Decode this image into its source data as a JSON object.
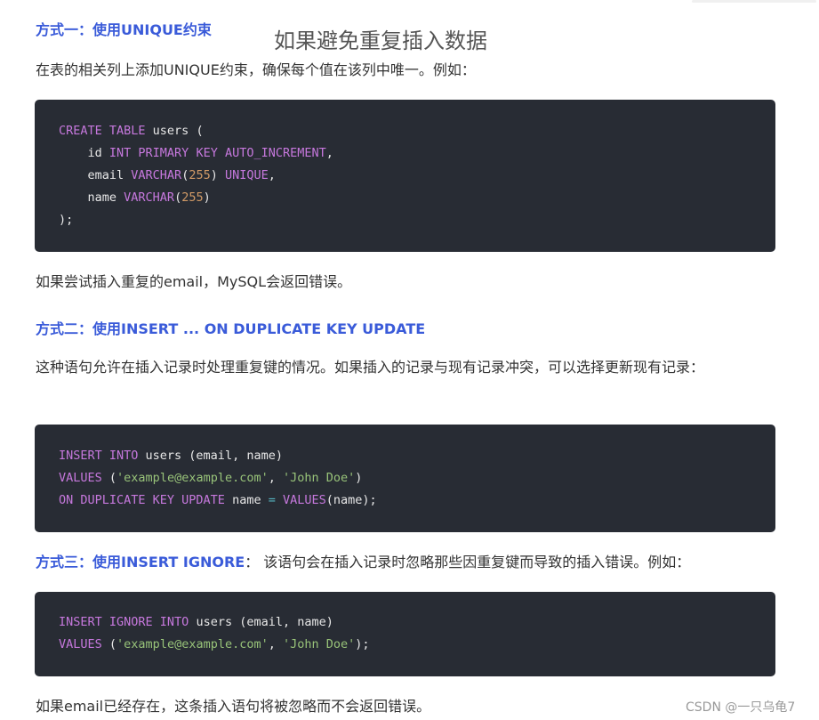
{
  "title": "如果避免重复插入数据",
  "section1": {
    "heading": "方式一：使用UNIQUE约束",
    "desc": "在表的相关列上添加UNIQUE约束，确保每个值在该列中唯一。例如：",
    "code": [
      [
        {
          "t": "kw",
          "v": "CREATE TABLE"
        },
        {
          "t": "plain",
          "v": " users ("
        }
      ],
      [
        {
          "t": "plain",
          "v": "    id "
        },
        {
          "t": "kw",
          "v": "INT PRIMARY KEY AUTO_INCREMENT"
        },
        {
          "t": "plain",
          "v": ","
        }
      ],
      [
        {
          "t": "plain",
          "v": "    email "
        },
        {
          "t": "kw",
          "v": "VARCHAR"
        },
        {
          "t": "plain",
          "v": "("
        },
        {
          "t": "num",
          "v": "255"
        },
        {
          "t": "plain",
          "v": ") "
        },
        {
          "t": "kw",
          "v": "UNIQUE"
        },
        {
          "t": "plain",
          "v": ","
        }
      ],
      [
        {
          "t": "plain",
          "v": "    name "
        },
        {
          "t": "kw",
          "v": "VARCHAR"
        },
        {
          "t": "plain",
          "v": "("
        },
        {
          "t": "num",
          "v": "255"
        },
        {
          "t": "plain",
          "v": ")"
        }
      ],
      [
        {
          "t": "plain",
          "v": ");"
        }
      ]
    ],
    "note": "如果尝试插入重复的email，MySQL会返回错误。"
  },
  "section2": {
    "heading": "方式二：使用INSERT ... ON DUPLICATE KEY UPDATE",
    "desc": "这种语句允许在插入记录时处理重复键的情况。如果插入的记录与现有记录冲突，可以选择更新现有记录：",
    "code": [
      [
        {
          "t": "kw",
          "v": "INSERT INTO"
        },
        {
          "t": "plain",
          "v": " users (email, name)"
        }
      ],
      [
        {
          "t": "kw",
          "v": "VALUES"
        },
        {
          "t": "plain",
          "v": " ("
        },
        {
          "t": "str",
          "v": "'example@example.com'"
        },
        {
          "t": "plain",
          "v": ", "
        },
        {
          "t": "str",
          "v": "'John Doe'"
        },
        {
          "t": "plain",
          "v": ")"
        }
      ],
      [
        {
          "t": "kw",
          "v": "ON DUPLICATE KEY UPDATE"
        },
        {
          "t": "plain",
          "v": " name "
        },
        {
          "t": "op",
          "v": "="
        },
        {
          "t": "plain",
          "v": " "
        },
        {
          "t": "kw",
          "v": "VALUES"
        },
        {
          "t": "plain",
          "v": "(name);"
        }
      ]
    ]
  },
  "section3": {
    "heading": "方式三：使用INSERT IGNORE",
    "desc": "： 该语句会在插入记录时忽略那些因重复键而导致的插入错误。例如：",
    "code": [
      [
        {
          "t": "kw",
          "v": "INSERT IGNORE INTO"
        },
        {
          "t": "plain",
          "v": " users (email, name)"
        }
      ],
      [
        {
          "t": "kw",
          "v": "VALUES"
        },
        {
          "t": "plain",
          "v": " ("
        },
        {
          "t": "str",
          "v": "'example@example.com'"
        },
        {
          "t": "plain",
          "v": ", "
        },
        {
          "t": "str",
          "v": "'John Doe'"
        },
        {
          "t": "plain",
          "v": ");"
        }
      ]
    ],
    "note": "如果email已经存在，这条插入语句将被忽略而不会返回错误。"
  },
  "watermark": "CSDN @一只乌龟7",
  "colors": {
    "heading": "#3a5bd9",
    "code_bg": "#282c34",
    "keyword": "#c678dd",
    "number": "#d19a66",
    "string": "#98c379"
  }
}
